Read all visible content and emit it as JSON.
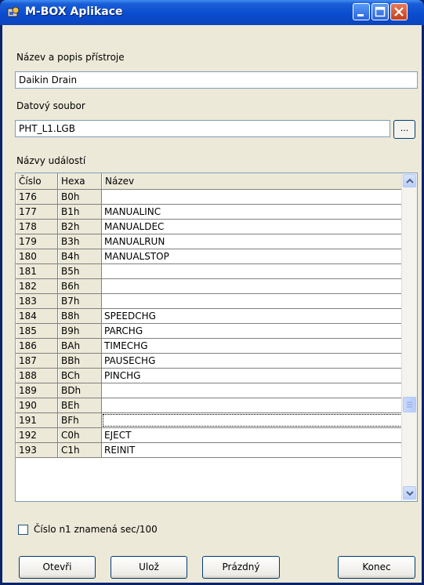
{
  "window": {
    "title": "M-BOX Aplikace"
  },
  "device": {
    "label": "Název a popis přístroje",
    "value": "Daikin Drain"
  },
  "datafile": {
    "label": "Datový soubor",
    "value": "PHT_L1.LGB",
    "browse_label": "..."
  },
  "events": {
    "label": "Názvy událostí",
    "columns": [
      "Číslo",
      "Hexa",
      "Název"
    ],
    "rows": [
      {
        "cislo": "176",
        "hexa": "B0h",
        "nazev": ""
      },
      {
        "cislo": "177",
        "hexa": "B1h",
        "nazev": "MANUALINC"
      },
      {
        "cislo": "178",
        "hexa": "B2h",
        "nazev": "MANUALDEC"
      },
      {
        "cislo": "179",
        "hexa": "B3h",
        "nazev": "MANUALRUN"
      },
      {
        "cislo": "180",
        "hexa": "B4h",
        "nazev": "MANUALSTOP"
      },
      {
        "cislo": "181",
        "hexa": "B5h",
        "nazev": ""
      },
      {
        "cislo": "182",
        "hexa": "B6h",
        "nazev": ""
      },
      {
        "cislo": "183",
        "hexa": "B7h",
        "nazev": ""
      },
      {
        "cislo": "184",
        "hexa": "B8h",
        "nazev": "SPEEDCHG"
      },
      {
        "cislo": "185",
        "hexa": "B9h",
        "nazev": "PARCHG"
      },
      {
        "cislo": "186",
        "hexa": "BAh",
        "nazev": "TIMECHG"
      },
      {
        "cislo": "187",
        "hexa": "BBh",
        "nazev": "PAUSECHG"
      },
      {
        "cislo": "188",
        "hexa": "BCh",
        "nazev": "PINCHG"
      },
      {
        "cislo": "189",
        "hexa": "BDh",
        "nazev": ""
      },
      {
        "cislo": "190",
        "hexa": "BEh",
        "nazev": ""
      },
      {
        "cislo": "191",
        "hexa": "BFh",
        "nazev": ""
      },
      {
        "cislo": "192",
        "hexa": "C0h",
        "nazev": "EJECT"
      },
      {
        "cislo": "193",
        "hexa": "C1h",
        "nazev": "REINIT"
      }
    ]
  },
  "checkbox": {
    "label": "Číslo n1 znamená sec/100",
    "checked": false
  },
  "buttons": {
    "open": "Otevři",
    "save": "Ulož",
    "empty": "Prázdný",
    "end": "Konec"
  }
}
